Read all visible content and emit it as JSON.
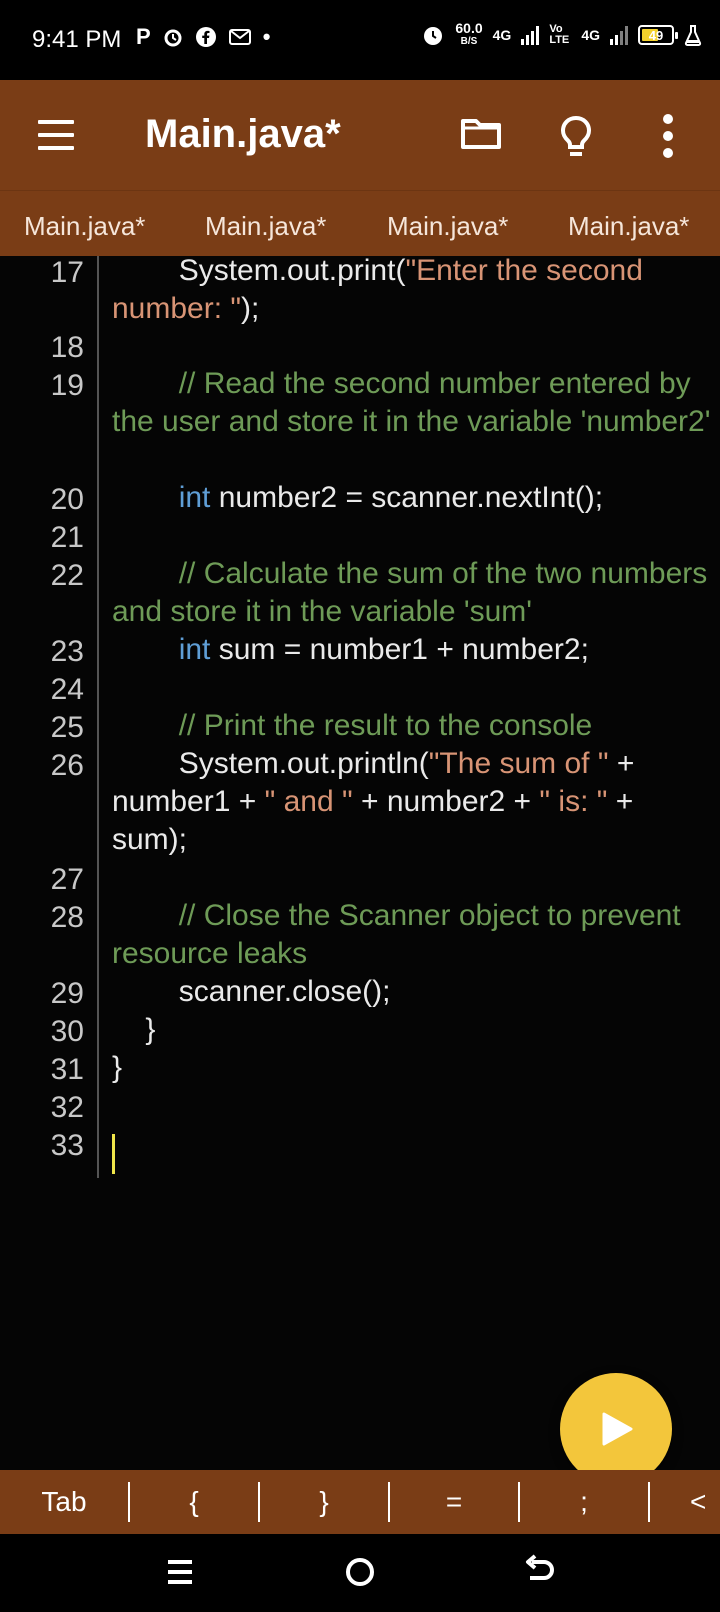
{
  "status": {
    "time": "9:41 PM",
    "left_icons": [
      "P",
      "alarm-icon",
      "facebook-icon",
      "gmail-icon",
      "•"
    ],
    "net_speed": "60.0",
    "net_speed_unit": "B/S",
    "net_type_1": "4G",
    "volte": "Vo LTE",
    "net_type_2": "4G",
    "battery_level": "49"
  },
  "appbar": {
    "title": "Main.java*",
    "bg_color": "#7a3d16"
  },
  "tabs": [
    "Main.java*",
    "Main.java*",
    "Main.java*",
    "Main.java*"
  ],
  "line_numbers": [
    "17",
    "18",
    "19",
    "20",
    "21",
    "22",
    "23",
    "24",
    "25",
    "26",
    "27",
    "28",
    "29",
    "30",
    "31",
    "32",
    "33"
  ],
  "code": {
    "l17a": "        System.out.print(",
    "l17s": "\"Enter the second number: \"",
    "l17b": ");",
    "l19": "        // Read the second number entered by the user and store it in the variable 'number2'",
    "l20kw": "int",
    "l20": " number2 = scanner.nextInt();",
    "l22": "        // Calculate the sum of the two numbers and store it in the variable 'sum'",
    "l23kw": "int",
    "l23": " sum = number1 + number2;",
    "l25": "        // Print the result to the console",
    "l26a": "        System.out.println(",
    "l26s1": "\"The sum of \"",
    "l26b": " + number1 + ",
    "l26s2": "\" and \"",
    "l26c": " + number2 + ",
    "l26s3": "\" is: \"",
    "l26d": " + sum);",
    "l28": "        // Close the Scanner object to prevent resource leaks",
    "l29": "        scanner.close();",
    "l30": "    }",
    "l31": "}"
  },
  "keybar": {
    "keys": [
      "Tab",
      "{",
      "}",
      "=",
      ";",
      "<"
    ]
  },
  "colors": {
    "accent": "#7a3d16",
    "fab": "#f3c63b",
    "comment": "#6e9b57",
    "string": "#d89475",
    "keyword": "#5f9ed6"
  }
}
